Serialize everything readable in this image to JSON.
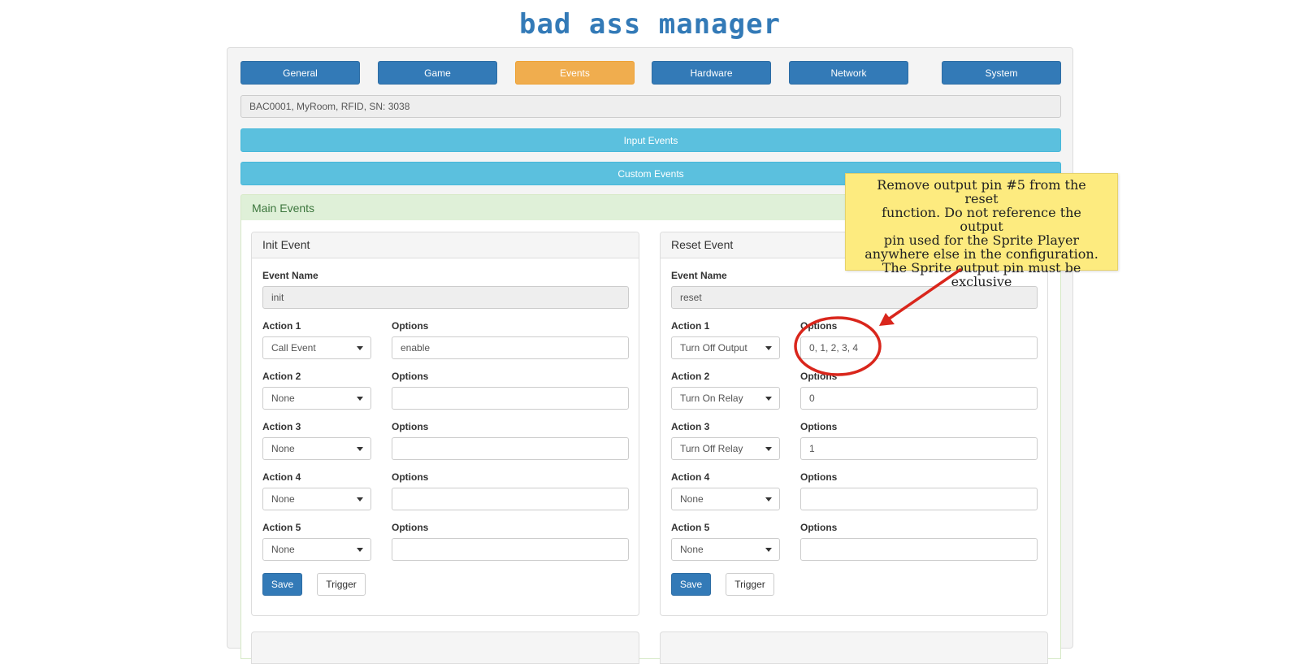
{
  "app": {
    "title": "bad ass manager"
  },
  "tabs": [
    {
      "label": "General"
    },
    {
      "label": "Game"
    },
    {
      "label": "Events"
    },
    {
      "label": "Hardware"
    },
    {
      "label": "Network"
    },
    {
      "label": "System"
    }
  ],
  "active_tab": "Events",
  "device_info": "BAC0001, MyRoom, RFID, SN: 3038",
  "sections": {
    "input_events": "Input Events",
    "custom_events": "Custom Events",
    "main_events": "Main Events"
  },
  "labels": {
    "event_name": "Event Name",
    "options": "Options",
    "action_1": "Action 1",
    "action_2": "Action 2",
    "action_3": "Action 3",
    "action_4": "Action 4",
    "action_5": "Action 5",
    "save": "Save",
    "trigger": "Trigger"
  },
  "init_event": {
    "title": "Init Event",
    "name": "init",
    "actions": [
      {
        "action": "Call Event",
        "options": "enable"
      },
      {
        "action": "None",
        "options": ""
      },
      {
        "action": "None",
        "options": ""
      },
      {
        "action": "None",
        "options": ""
      },
      {
        "action": "None",
        "options": ""
      }
    ]
  },
  "reset_event": {
    "title": "Reset Event",
    "name": "reset",
    "actions": [
      {
        "action": "Turn Off Output",
        "options": "0, 1, 2, 3, 4"
      },
      {
        "action": "Turn On Relay",
        "options": "0"
      },
      {
        "action": "Turn Off Relay",
        "options": "1"
      },
      {
        "action": "None",
        "options": ""
      },
      {
        "action": "None",
        "options": ""
      }
    ]
  },
  "annotation": {
    "note_lines": [
      "Remove output pin #5 from the reset",
      "function. Do not reference the output",
      "pin used for the Sprite Player",
      "anywhere else in the configuration.",
      "The Sprite output pin must be",
      "exclusive"
    ],
    "note_color": "#fdeb7f",
    "marker_color": "#d9261c"
  },
  "colors": {
    "primary": "#337ab7",
    "active_tab": "#f0ad4e",
    "info": "#5bc0de",
    "success_bg": "#dff0d8",
    "success_text": "#3c763d"
  }
}
